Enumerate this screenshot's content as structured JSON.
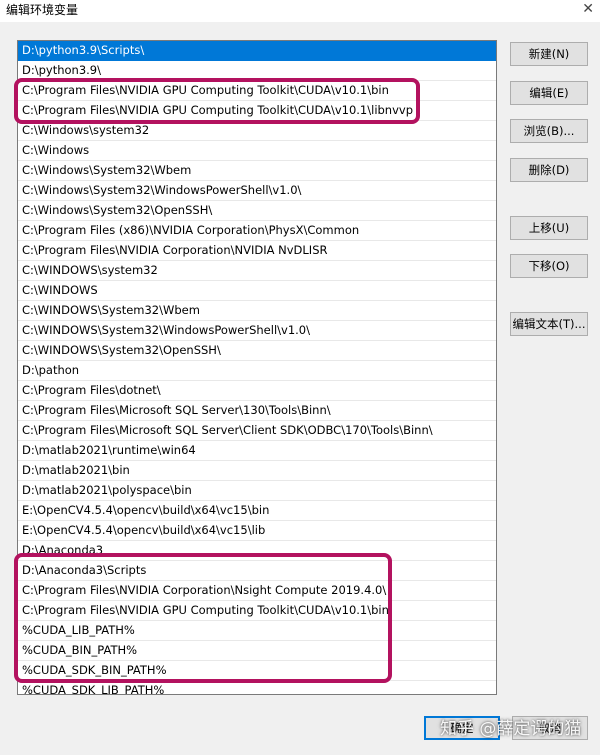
{
  "window": {
    "title": "编辑环境变量"
  },
  "path_list": {
    "selected_index": 0,
    "items": [
      "D:\\python3.9\\Scripts\\",
      "D:\\python3.9\\",
      "C:\\Program Files\\NVIDIA GPU Computing Toolkit\\CUDA\\v10.1\\bin",
      "C:\\Program Files\\NVIDIA GPU Computing Toolkit\\CUDA\\v10.1\\libnvvp",
      "C:\\Windows\\system32",
      "C:\\Windows",
      "C:\\Windows\\System32\\Wbem",
      "C:\\Windows\\System32\\WindowsPowerShell\\v1.0\\",
      "C:\\Windows\\System32\\OpenSSH\\",
      "C:\\Program Files (x86)\\NVIDIA Corporation\\PhysX\\Common",
      "C:\\Program Files\\NVIDIA Corporation\\NVIDIA NvDLISR",
      "C:\\WINDOWS\\system32",
      "C:\\WINDOWS",
      "C:\\WINDOWS\\System32\\Wbem",
      "C:\\WINDOWS\\System32\\WindowsPowerShell\\v1.0\\",
      "C:\\WINDOWS\\System32\\OpenSSH\\",
      "D:\\pathon",
      "C:\\Program Files\\dotnet\\",
      "C:\\Program Files\\Microsoft SQL Server\\130\\Tools\\Binn\\",
      "C:\\Program Files\\Microsoft SQL Server\\Client SDK\\ODBC\\170\\Tools\\Binn\\",
      "D:\\matlab2021\\runtime\\win64",
      "D:\\matlab2021\\bin",
      "D:\\matlab2021\\polyspace\\bin",
      "E:\\OpenCV4.5.4\\opencv\\build\\x64\\vc15\\bin",
      "E:\\OpenCV4.5.4\\opencv\\build\\x64\\vc15\\lib",
      "D:\\Anaconda3",
      "D:\\Anaconda3\\Scripts",
      "C:\\Program Files\\NVIDIA Corporation\\Nsight Compute 2019.4.0\\",
      "C:\\Program Files\\NVIDIA GPU Computing Toolkit\\CUDA\\v10.1\\bin",
      "%CUDA_LIB_PATH%",
      "%CUDA_BIN_PATH%",
      "%CUDA_SDK_BIN_PATH%",
      "%CUDA_SDK_LIB_PATH%",
      "",
      ""
    ]
  },
  "buttons": {
    "new": "新建(N)",
    "edit": "编辑(E)",
    "browse": "浏览(B)...",
    "delete": "删除(D)",
    "move_up": "上移(U)",
    "move_down": "下移(O)",
    "edit_text": "编辑文本(T)..."
  },
  "bottom_buttons": {
    "ok": "确定",
    "cancel": "取消"
  },
  "annotation": {
    "color": "#b3125f"
  },
  "watermark": "知乎 @薛定谔的猫"
}
